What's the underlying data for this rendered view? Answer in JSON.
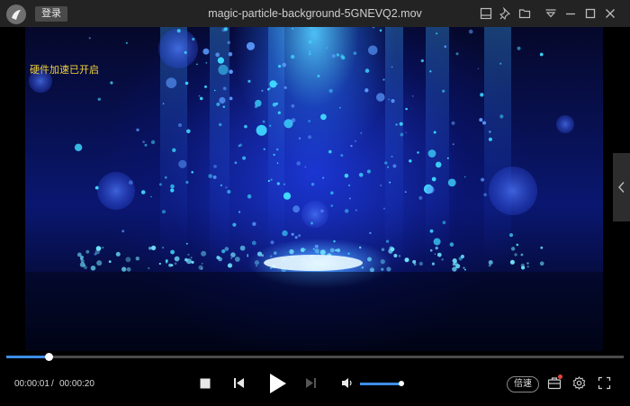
{
  "window": {
    "title": "magic-particle-background-5GNEVQ2.mov",
    "login_label": "登录"
  },
  "titlebar_icons": [
    "mini-mode-icon",
    "pin-icon",
    "folder-icon",
    "menu-icon",
    "minimize-icon",
    "maximize-icon",
    "close-icon"
  ],
  "video": {
    "hw_accel_notice": "硬件加速已开启"
  },
  "playback": {
    "current_time": "00:00:01",
    "separator": "/",
    "total_time": "00:00:20",
    "progress": 0.068,
    "volume": 1.0
  },
  "controls": {
    "speed_label": "倍速"
  },
  "colors": {
    "accent": "#3d8ee8",
    "notice": "#f2d23a",
    "badge": "#e8443a"
  }
}
